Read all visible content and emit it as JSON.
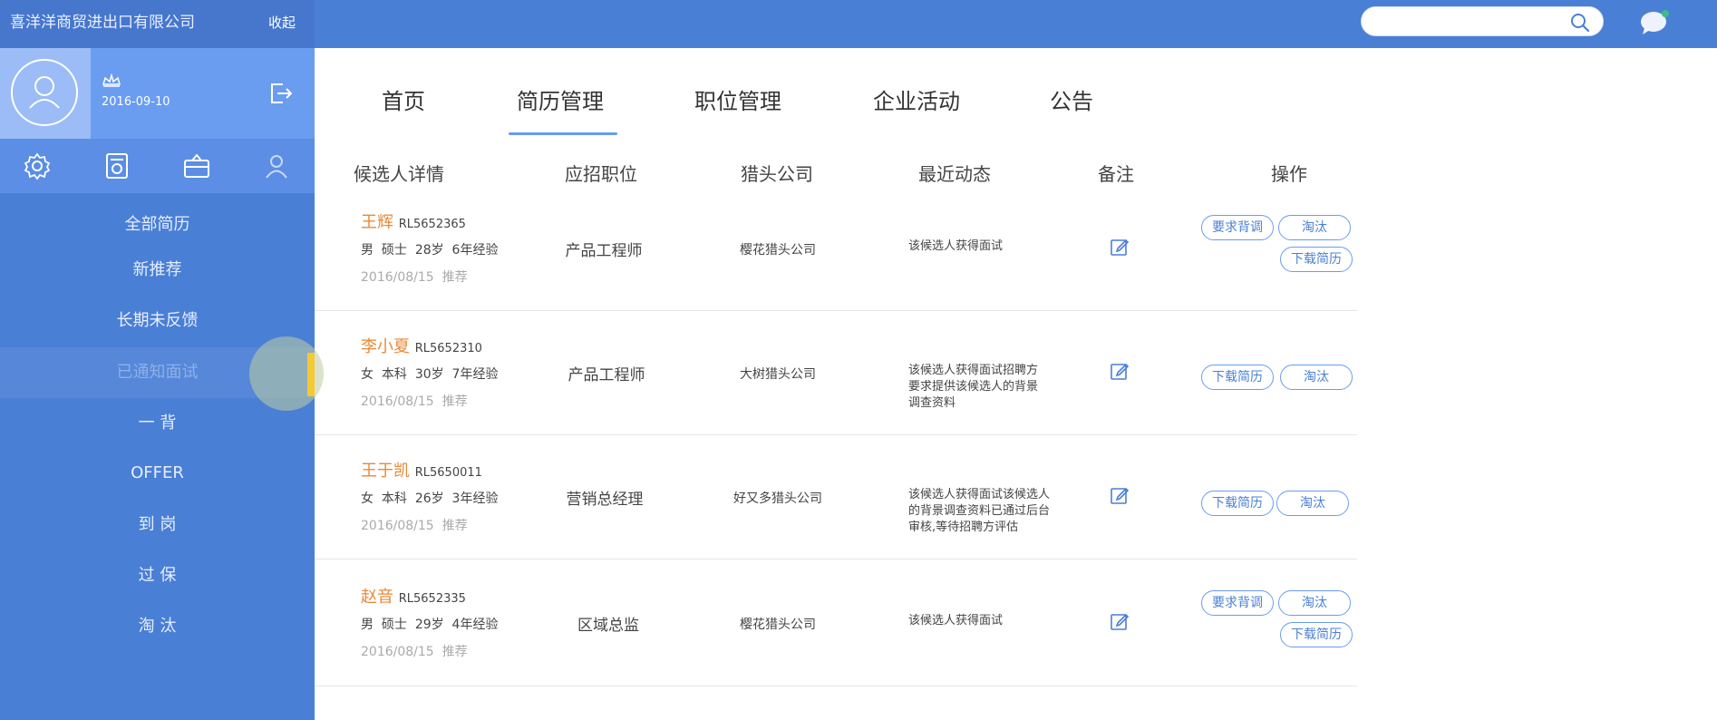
{
  "sidebar": {
    "company_name": "喜洋洋商贸进出口有限公司",
    "collapse_label": "收起",
    "date": "2016-09-10",
    "menu": [
      "全部简历",
      "新推荐",
      "长期未反馈",
      "已通知面试",
      "一 背",
      "OFFER",
      "到 岗",
      "过 保",
      "淘 汰"
    ],
    "active_menu_index": 3,
    "icons": [
      "gear-icon",
      "resume-icon",
      "briefcase-icon",
      "user-icon"
    ]
  },
  "nav": {
    "tabs": [
      "首页",
      "简历管理",
      "职位管理",
      "企业活动",
      "公告"
    ],
    "active_tab_index": 1
  },
  "table": {
    "headers": [
      "候选人详情",
      "应招职位",
      "猎头公司",
      "最近动态",
      "备注",
      "操作"
    ],
    "rows": [
      {
        "name": "王辉",
        "id": "RL5652365",
        "gender": "男",
        "degree": "硕士",
        "age": "28岁",
        "exp": "6年经验",
        "date": "2016/08/15",
        "tag": "推荐",
        "position": "产品工程师",
        "hunter": "樱花猎头公司",
        "dynamics": "该候选人获得面试",
        "buttons": [
          "要求背调",
          "淘汰",
          "下载简历"
        ]
      },
      {
        "name": "李小夏",
        "id": "RL5652310",
        "gender": "女",
        "degree": "本科",
        "age": "30岁",
        "exp": "7年经验",
        "date": "2016/08/15",
        "tag": "推荐",
        "position": "产品工程师",
        "hunter": "大树猎头公司",
        "dynamics": "该候选人获得面试招聘方要求提供该候选人的背景调查资料",
        "buttons": [
          "下载简历",
          "淘汰"
        ]
      },
      {
        "name": "王于凯",
        "id": "RL5650011",
        "gender": "女",
        "degree": "本科",
        "age": "26岁",
        "exp": "3年经验",
        "date": "2016/08/15",
        "tag": "推荐",
        "position": "营销总经理",
        "hunter": "好又多猎头公司",
        "dynamics": "该候选人获得面试该候选人的背景调查资料已通过后台审核,等待招聘方评估",
        "buttons": [
          "下载简历",
          "淘汰"
        ]
      },
      {
        "name": "赵音",
        "id": "RL5652335",
        "gender": "男",
        "degree": "硕士",
        "age": "29岁",
        "exp": "4年经验",
        "date": "2016/08/15",
        "tag": "推荐",
        "position": "区域总监",
        "hunter": "樱花猎头公司",
        "dynamics": "该候选人获得面试",
        "buttons": [
          "要求背调",
          "淘汰",
          "下载简历"
        ]
      }
    ]
  },
  "colors": {
    "primary": "#4a7fd6",
    "accent_orange": "#e8893a",
    "highlight_yellow": "#f4c934"
  }
}
